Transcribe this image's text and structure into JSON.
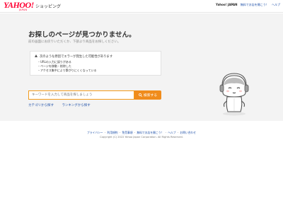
{
  "header": {
    "logo_text": "YAHOO!",
    "logo_sub": "JAPAN",
    "service_name": "ショッピング",
    "links": [
      {
        "label": "Yahoo! JAPAN",
        "strong": true
      },
      {
        "label": "無料でお店を開こう！",
        "strong": false
      },
      {
        "label": "ヘルプ",
        "strong": false
      }
    ]
  },
  "main": {
    "title": "お探しのページが見つかりません。",
    "subtitle": "前の画面にお戻りいただくか、下部より商品をお探しください。",
    "notice": {
      "heading": "次のような原因でエラーが発生した可能性があります",
      "items": [
        "URLの入力に誤りがある",
        "ページを移動・削除した",
        "アクセス集中により繋がりにくくなっている"
      ]
    },
    "search": {
      "placeholder": "キーワードを入力して商品を探しましょう",
      "button_label": "検索する"
    },
    "links": {
      "category": "カテゴリから探す",
      "ranking": "ランキングから探す"
    }
  },
  "footer": {
    "links": [
      "プライバシー",
      "利用規約",
      "免責事項",
      "無料でお店を開こう！",
      "ヘルプ",
      "お問い合わせ"
    ],
    "copyright": "Copyright (C) 2022 Yahoo Japan Corporation. All Rights Reserved."
  },
  "colors": {
    "accent": "#f08c1c",
    "brand": "#ff0033",
    "link": "#1d4fa8"
  }
}
